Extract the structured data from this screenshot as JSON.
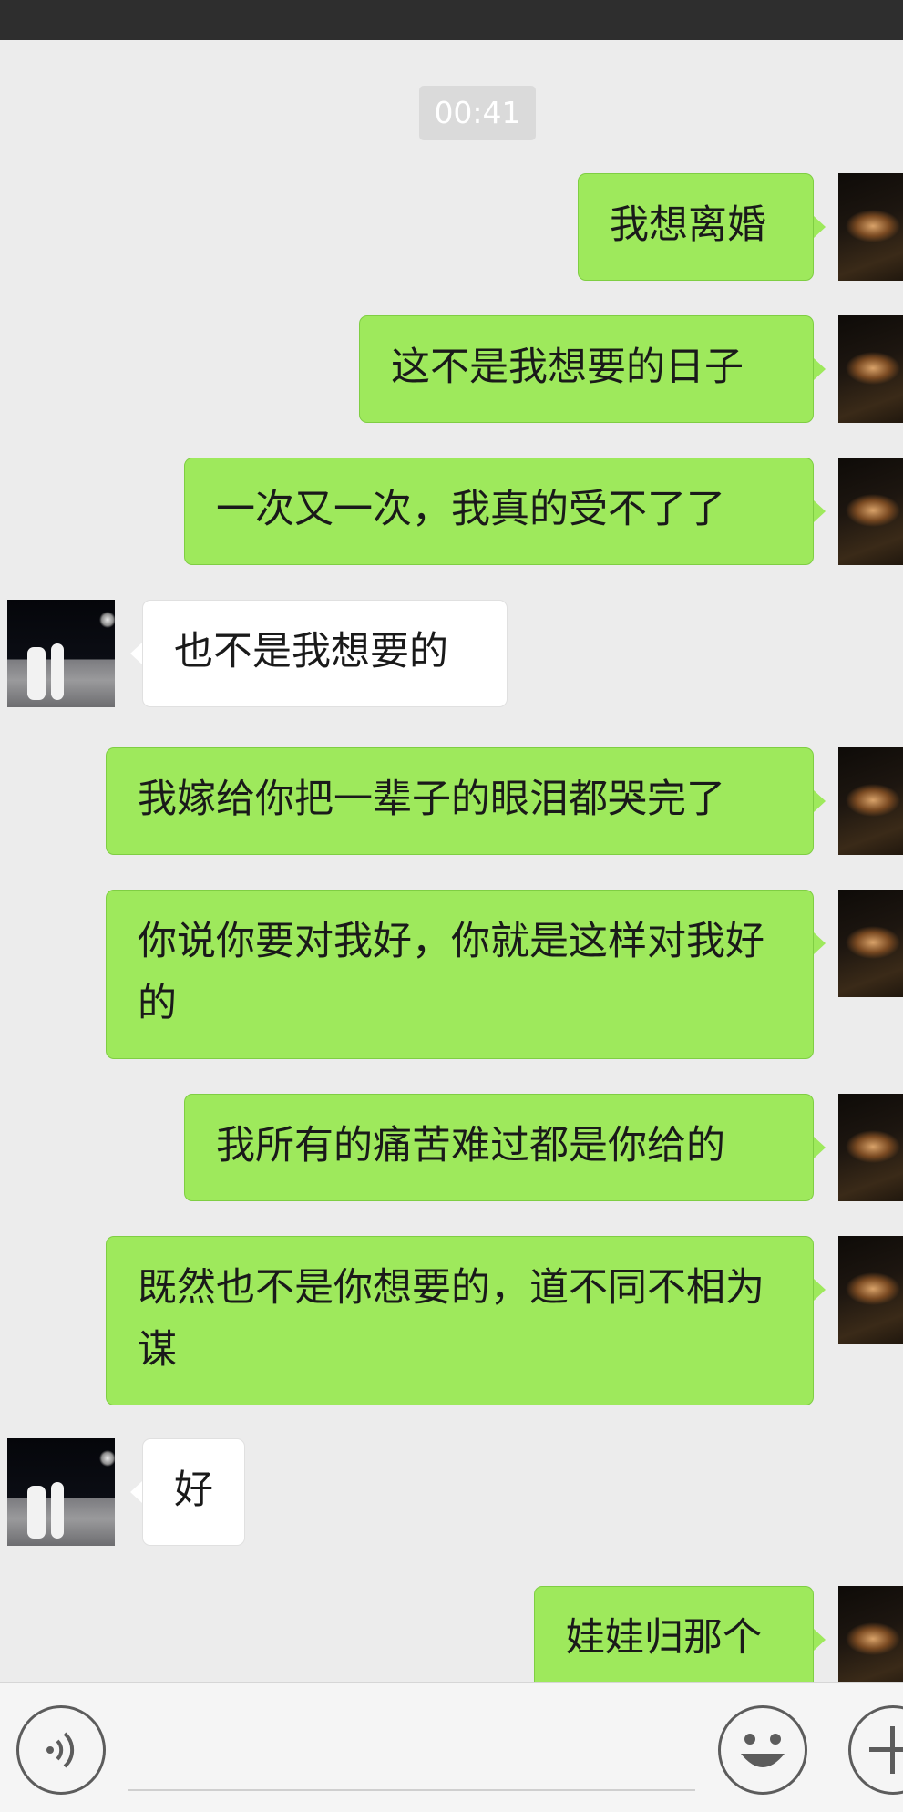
{
  "status_bar": {},
  "chat": {
    "timestamp": "00:41",
    "messages": [
      {
        "sender": "self",
        "text": "我想离婚"
      },
      {
        "sender": "self",
        "text": "这不是我想要的日子"
      },
      {
        "sender": "self",
        "text": "一次又一次，我真的受不了了"
      },
      {
        "sender": "other",
        "text": "也不是我想要的"
      },
      {
        "sender": "self",
        "text": "我嫁给你把一辈子的眼泪都哭完了"
      },
      {
        "sender": "self",
        "text": "你说你要对我好，你就是这样对我好的"
      },
      {
        "sender": "self",
        "text": "我所有的痛苦难过都是你给的"
      },
      {
        "sender": "self",
        "text": "既然也不是你想要的，道不同不相为谋"
      },
      {
        "sender": "other",
        "text": "好"
      },
      {
        "sender": "self",
        "text": "娃娃归那个"
      }
    ]
  },
  "input_bar": {
    "voice_icon": "voice-icon",
    "emoji_icon": "emoji-icon",
    "plus_icon": "plus-icon",
    "text": ""
  },
  "colors": {
    "outgoing_bubble": "#9ee95c",
    "incoming_bubble": "#ffffff",
    "background": "#ececec",
    "top_bar": "#2e2e2e"
  }
}
